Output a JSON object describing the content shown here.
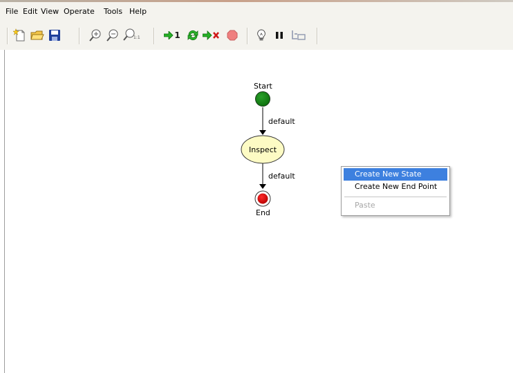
{
  "menubar": {
    "items": [
      "File",
      "Edit",
      "View",
      "Operate",
      "Tools",
      "Help"
    ]
  },
  "toolbar": {
    "buttons": [
      {
        "icon": "new-icon"
      },
      {
        "icon": "open-folder-icon"
      },
      {
        "icon": "save-icon"
      },
      {
        "icon": "zoom-in-icon"
      },
      {
        "icon": "zoom-out-icon"
      },
      {
        "icon": "zoom-actual-icon",
        "label": "1:1"
      },
      {
        "icon": "step-one-icon",
        "label": "1"
      },
      {
        "icon": "cycle-icon"
      },
      {
        "icon": "remove-icon"
      },
      {
        "icon": "stop-icon"
      },
      {
        "icon": "lightbulb-icon"
      },
      {
        "icon": "pause-icon"
      },
      {
        "icon": "branch-icon"
      }
    ]
  },
  "diagram": {
    "start_label": "Start",
    "edge1_label": "default",
    "state_label": "Inspect",
    "edge2_label": "default",
    "end_label": "End",
    "colors": {
      "start": "#0c7a0c",
      "state": "#fdfbc4",
      "end": "#d10a0a"
    }
  },
  "context_menu": {
    "items": [
      "Create New State",
      "Create New End Point",
      "Paste"
    ],
    "highlighted": "Create New State",
    "disabled": "Paste"
  }
}
